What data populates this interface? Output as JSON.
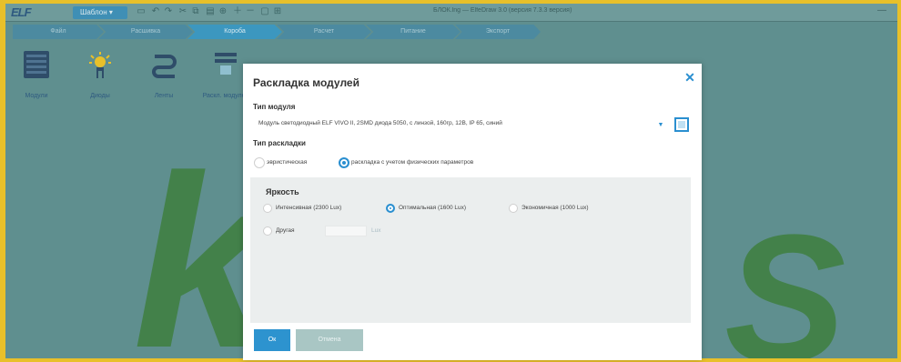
{
  "app": {
    "logo": "ELF",
    "project_button": "Шаблон ▾",
    "title": "БЛОК.lng — ElfeDraw 3.0 (версия 7.3.3 версия)",
    "minimize": "—"
  },
  "toolbar": {
    "qa_icons": [
      "floppy-icon",
      "undo-icon",
      "redo-icon",
      "cut-icon",
      "copy-icon",
      "paste-icon",
      "align-icon",
      "zoom-in-icon",
      "zoom-out-icon",
      "fit-icon"
    ]
  },
  "steps": [
    "Файл",
    "Расшивка",
    "Короба",
    "Расчет",
    "Питание",
    "Экспорт"
  ],
  "ribbon": {
    "items": [
      {
        "label": "Модули",
        "icon": "modules-icon"
      },
      {
        "label": "Диоды",
        "icon": "diode-icon"
      },
      {
        "label": "Ленты",
        "icon": "tape-icon"
      },
      {
        "label": "Раскл.\nмодулей",
        "icon": "layout-icon"
      }
    ]
  },
  "watermark": {
    "left": "k",
    "right": "S"
  },
  "dialog": {
    "title": "Раскладка модулей",
    "close": "✕",
    "module_type_label": "Тип модуля",
    "module_type_value": "Модуль светодиодный ELF VIVO II, 2SMD диода 5050, с линзой, 160гр, 12В, IP 65, синий",
    "layout_type_label": "Тип раскладки",
    "layout_options": [
      {
        "label": "эвристическая",
        "selected": false
      },
      {
        "label": "раскладка с учетом физических параметров",
        "selected": true
      }
    ],
    "brightness_label": "Яркость",
    "brightness_options": [
      {
        "label": "Интенсивная (2300 Lux)",
        "selected": false
      },
      {
        "label": "Оптимальная (1600 Lux)",
        "selected": true
      },
      {
        "label": "Экономичная (1000 Lux)",
        "selected": false
      },
      {
        "label": "Другая",
        "selected": false
      }
    ],
    "other_unit": "Lux",
    "ok": "Ок",
    "cancel": "Отмена"
  }
}
